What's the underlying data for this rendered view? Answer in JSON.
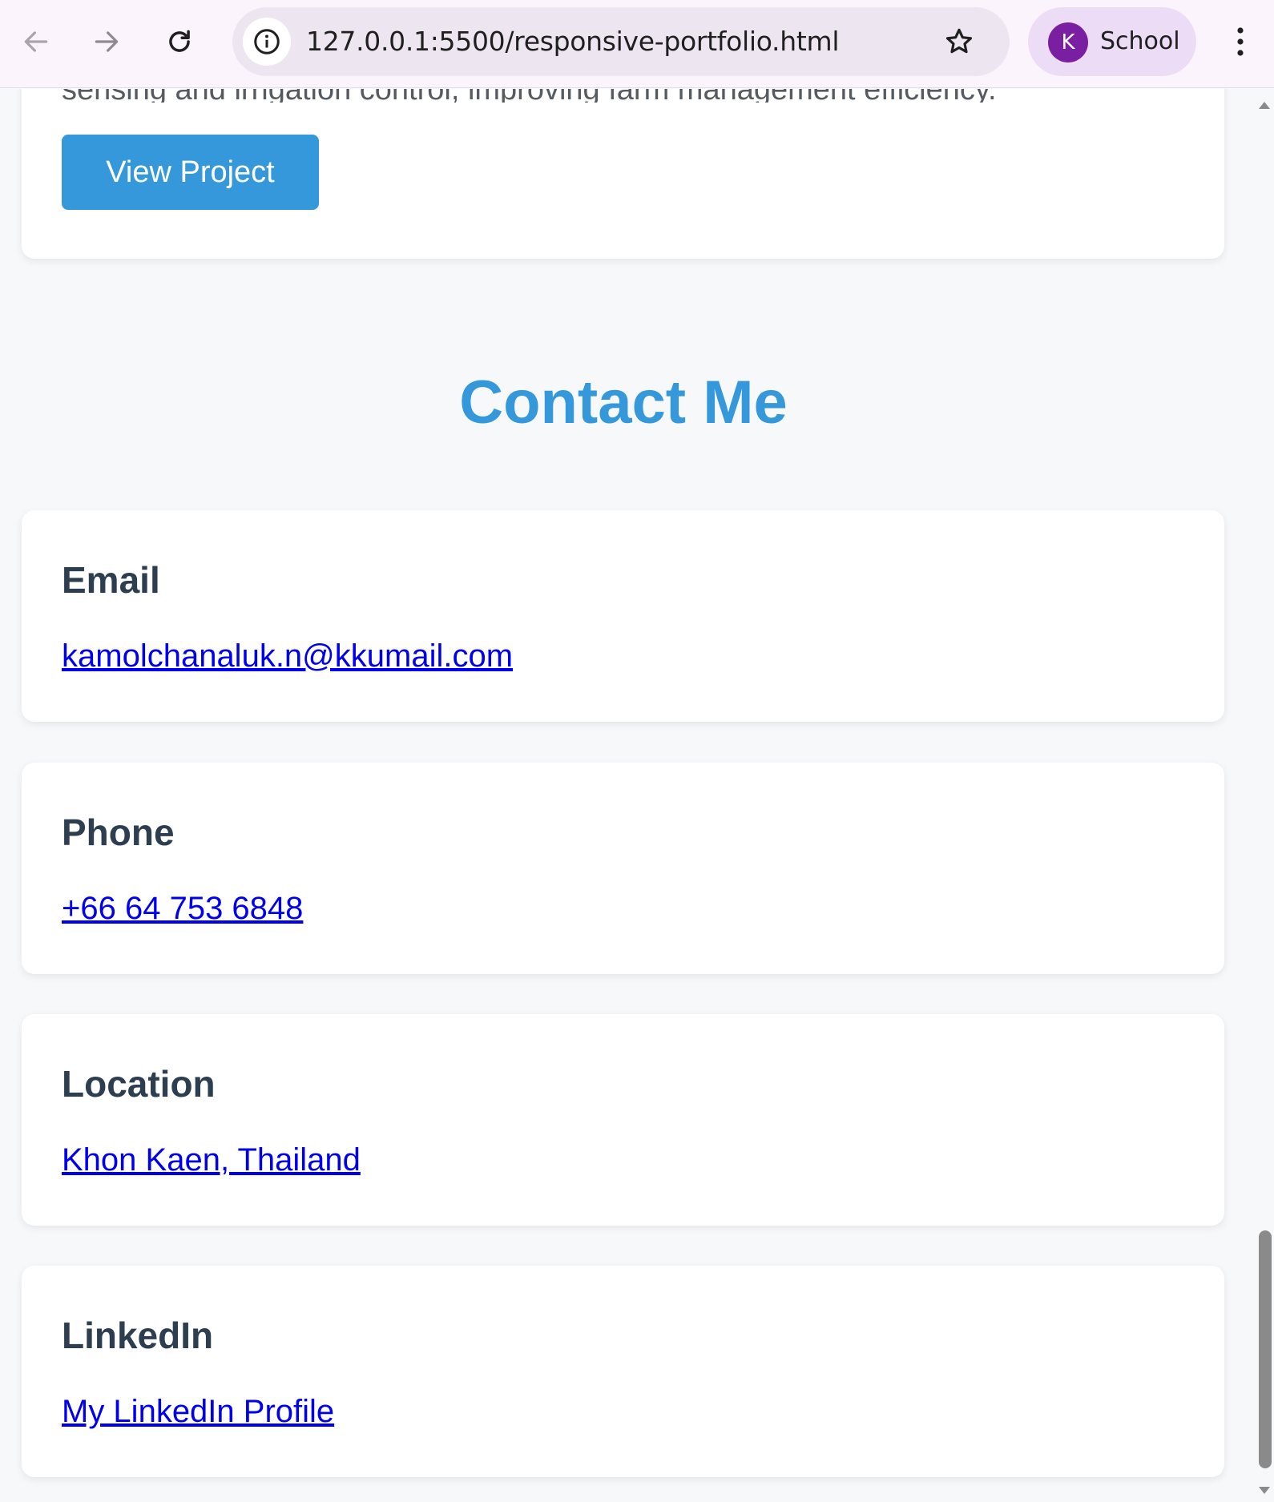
{
  "browser": {
    "url": "127.0.0.1:5500/responsive-portfolio.html",
    "profile_initial": "K",
    "profile_name": "School",
    "icons": {
      "back": "back-arrow-icon",
      "forward": "forward-arrow-icon",
      "reload": "reload-icon",
      "site_info": "info-icon",
      "bookmark": "star-icon",
      "menu": "kebab-menu-icon"
    }
  },
  "project": {
    "description_partial": "sensing and irrigation control, improving farm management efficiency.",
    "button_label": "View Project"
  },
  "contact": {
    "title": "Contact Me",
    "items": [
      {
        "heading": "Email",
        "link": "kamolchanaluk.n@kkumail.com"
      },
      {
        "heading": "Phone",
        "link": "+66 64 753 6848"
      },
      {
        "heading": "Location",
        "link": "Khon Kaen, Thailand"
      },
      {
        "heading": "LinkedIn",
        "link": "My LinkedIn Profile"
      }
    ]
  },
  "colors": {
    "accent": "#3498db",
    "heading": "#2c3e50",
    "link": "#0000ee",
    "page_bg": "#f7f8fa",
    "card_bg": "#ffffff"
  }
}
